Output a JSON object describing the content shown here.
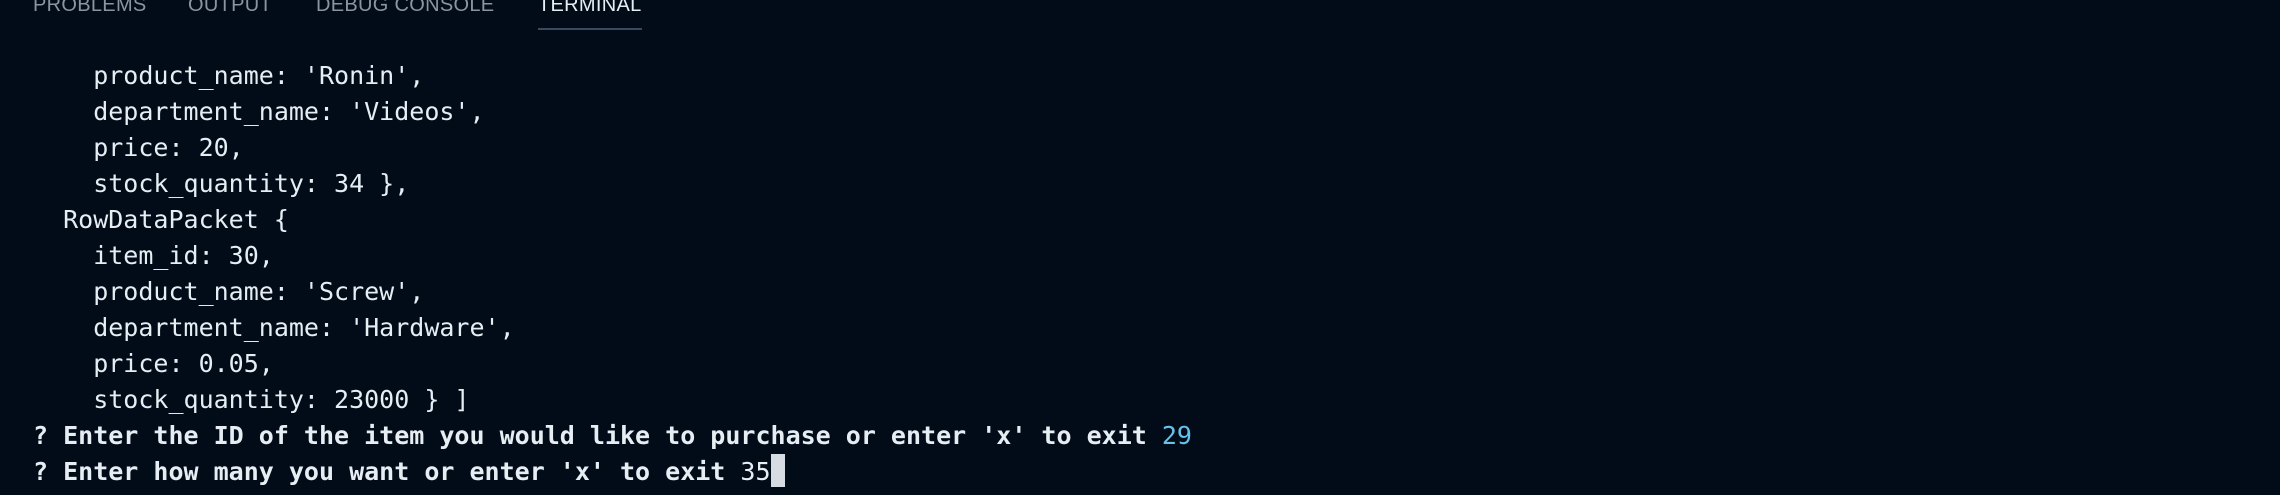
{
  "tabs": [
    {
      "label": "PROBLEMS",
      "active": false
    },
    {
      "label": "OUTPUT",
      "active": false
    },
    {
      "label": "DEBUG CONSOLE",
      "active": false
    },
    {
      "label": "TERMINAL",
      "active": true
    }
  ],
  "terminal": {
    "lines": [
      "    product_name: 'Ronin',",
      "    department_name: 'Videos',",
      "    price: 20,",
      "    stock_quantity: 34 },",
      "  RowDataPacket {",
      "    item_id: 30,",
      "    product_name: 'Screw',",
      "    department_name: 'Hardware',",
      "    price: 0.05,",
      "    stock_quantity: 23000 } ]"
    ],
    "prompt1": {
      "question": "? Enter the ID of the item you would like to purchase or enter 'x' to exit ",
      "answer": "29"
    },
    "prompt2": {
      "question": "? Enter how many you want or enter 'x' to exit ",
      "input": "35"
    }
  },
  "colors": {
    "background": "#010c18",
    "text": "#e6edf3",
    "answer": "#66c2e8",
    "inactive_tab": "#8b95a2"
  }
}
